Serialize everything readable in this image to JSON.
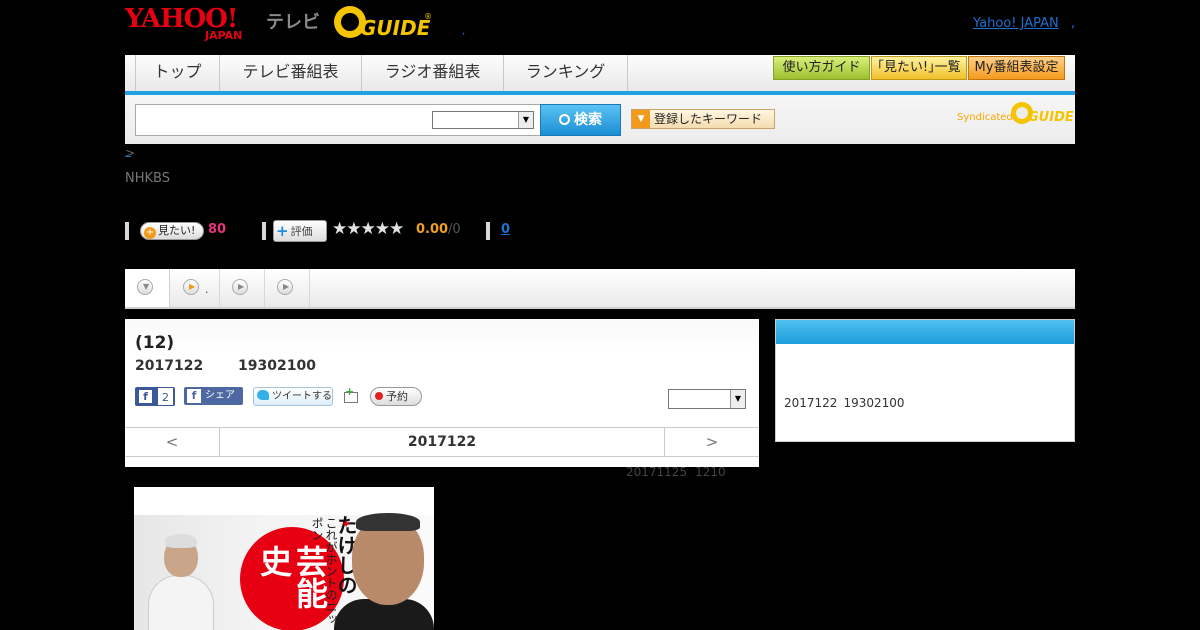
{
  "header": {
    "yahoo_logo_top": "YAHOO!",
    "yahoo_logo_bottom": "JAPAN",
    "tv_label": "テレビ",
    "gguide_logo": "GUIDE",
    "gguide_reg": "®",
    "top_dot": ",",
    "yahoo_japan_link": "Yahoo! JAPAN",
    "yahoo_japan_sep": ","
  },
  "nav": {
    "tabs": [
      {
        "label": "トップ"
      },
      {
        "label": "テレビ番組表"
      },
      {
        "label": "ラジオ番組表"
      },
      {
        "label": "ランキング"
      }
    ],
    "buttons": [
      {
        "label": "使い方ガイド"
      },
      {
        "label": "｢見たい!｣一覧"
      },
      {
        "label": "My番組表設定"
      }
    ]
  },
  "search": {
    "value": "",
    "select_value": "",
    "button_label": "検索",
    "keyword_button": "登録したキーワード",
    "syndicated": "Syndicated",
    "synd_logo": "GUIDE"
  },
  "breadcrumb": ">",
  "channel": "NHKBS",
  "stats": {
    "mitai_label": "見たい!",
    "mitai_count": "80",
    "hyoka_label": "評価",
    "stars": "★★★★★",
    "score": "0.00",
    "score_total": "/0",
    "comment_count": "0"
  },
  "program_tabs": [
    {
      "label": ""
    },
    {
      "label": "."
    },
    {
      "label": ""
    },
    {
      "label": ""
    }
  ],
  "program": {
    "title": "(12)",
    "date": "2017122",
    "time": "19302100",
    "fb_like_count": "2",
    "fb_share_label": "シェア",
    "tweet_label": "ツイートする",
    "yoyaku_label": "予約",
    "select_value": "",
    "pager_prev": "<",
    "pager_date": "2017122",
    "pager_next": ">",
    "updated_date": "20171125",
    "updated_time": "1210"
  },
  "side": {
    "date": "2017122",
    "time": "19302100"
  },
  "image": {
    "title_big": "芸能史",
    "title_small": "これがホントのニッポン",
    "title_takeshi": "たけしの"
  },
  "colors": {
    "yahoo_red": "#e60012",
    "gguide_yellow": "#f5c400",
    "accent_blue": "#1fa1e3",
    "mitai_pink": "#e8357a",
    "score_orange": "#f0a020"
  }
}
